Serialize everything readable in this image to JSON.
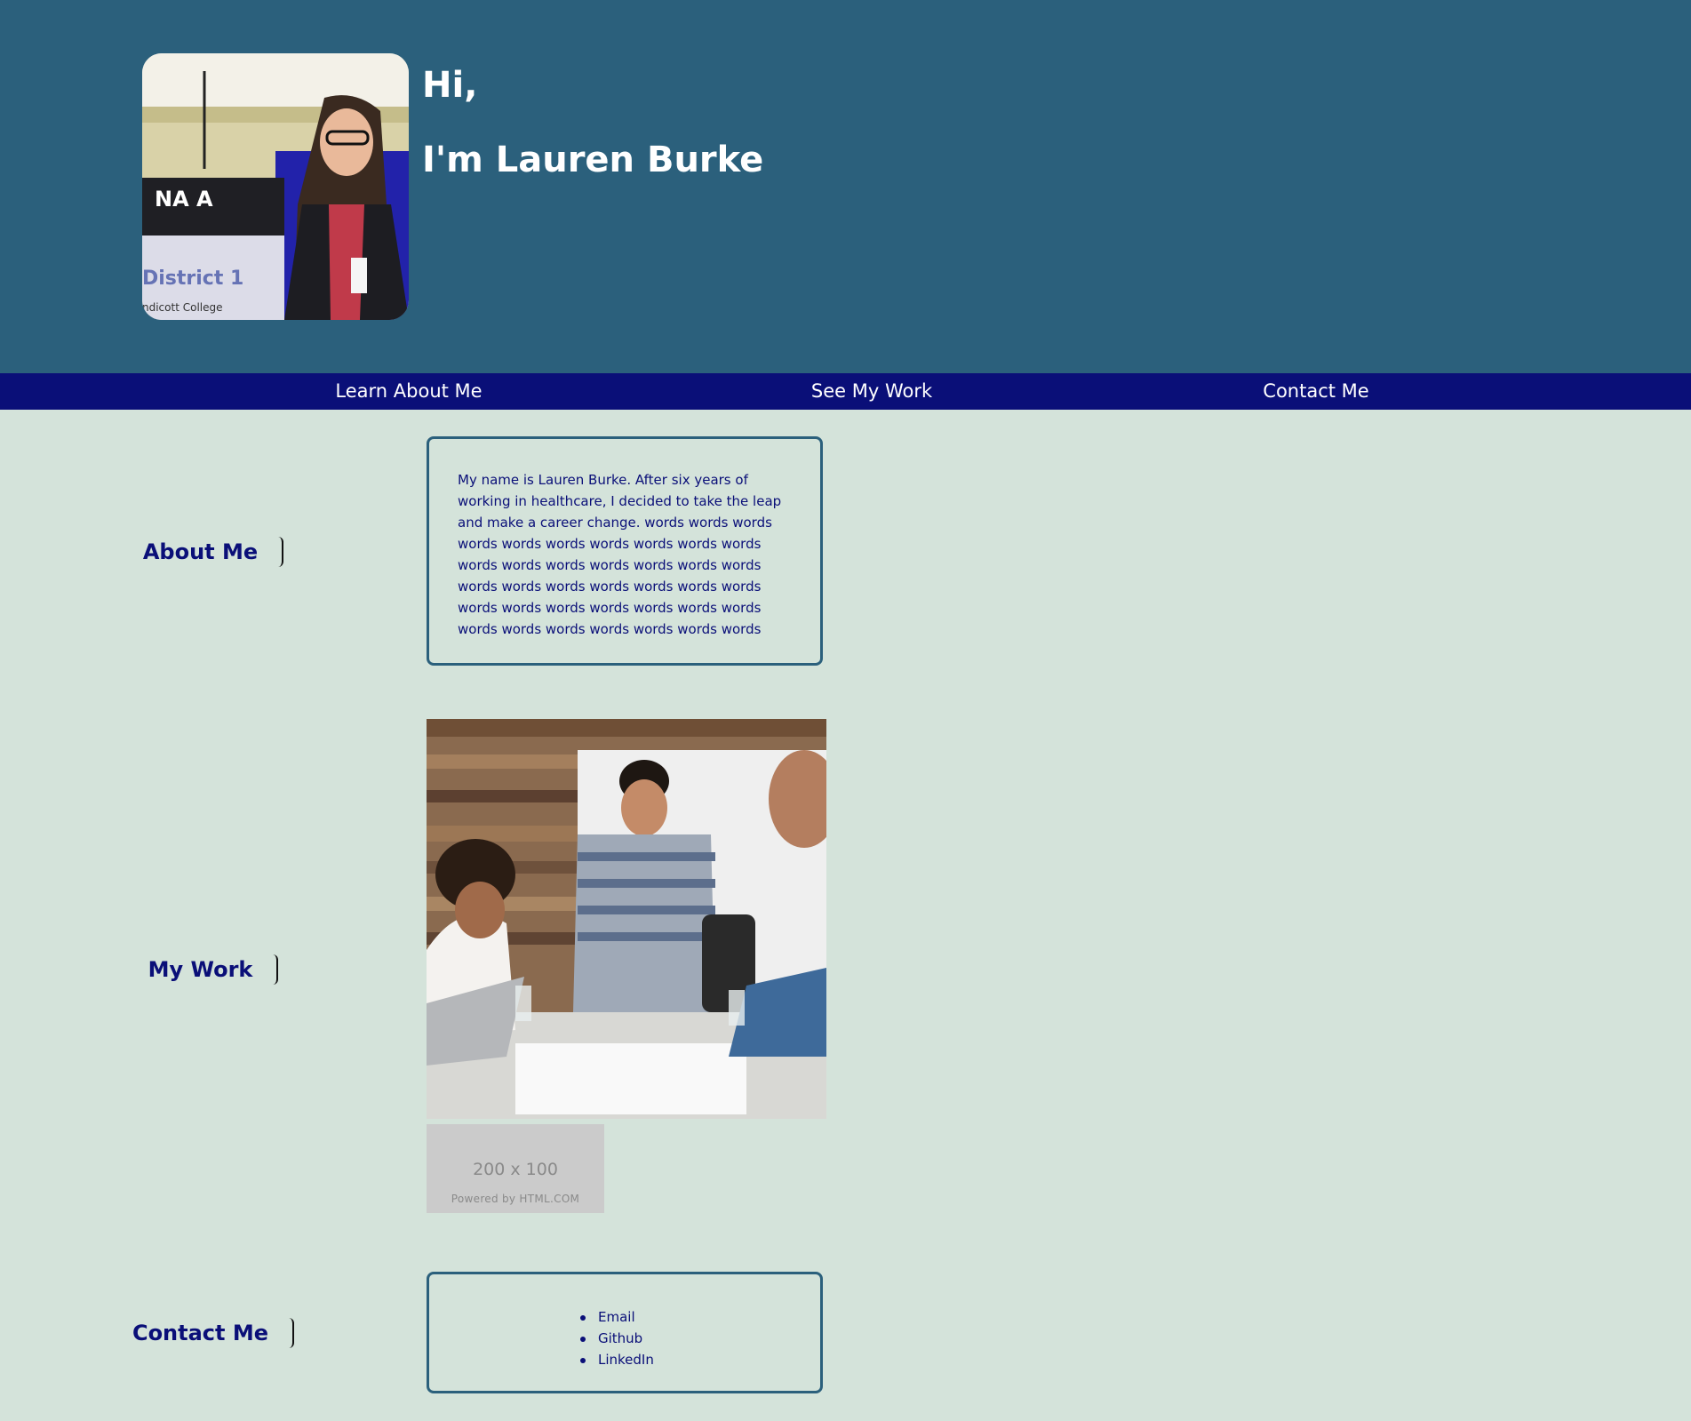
{
  "header": {
    "greeting": "Hi,",
    "name_line": "I'm Lauren Burke",
    "profile_photo_alt": "Lauren Burke profile photo"
  },
  "nav": [
    {
      "label": "Learn About Me"
    },
    {
      "label": "See My Work"
    },
    {
      "label": "Contact Me"
    }
  ],
  "about": {
    "heading": "About Me",
    "body": "My name is Lauren Burke. After six years of working in healthcare, I decided to take the leap and make a career change. words words words words words words words words words words words words words words words words words words words words words words words words words words words words words words words words words words words words words words"
  },
  "work": {
    "heading": "My Work",
    "image_alt": "Team collaborating over papers at a table",
    "placeholder": {
      "size_text": "200 x 100",
      "powered_text": "Powered by HTML.COM"
    }
  },
  "contact": {
    "heading": "Contact Me",
    "links": [
      {
        "label": "Email"
      },
      {
        "label": "Github"
      },
      {
        "label": "LinkedIn"
      }
    ]
  },
  "colors": {
    "hero_bg": "#2b607c",
    "nav_bg": "#0a0f78",
    "page_bg": "#d4e3da",
    "accent_text": "#0a0f78"
  }
}
